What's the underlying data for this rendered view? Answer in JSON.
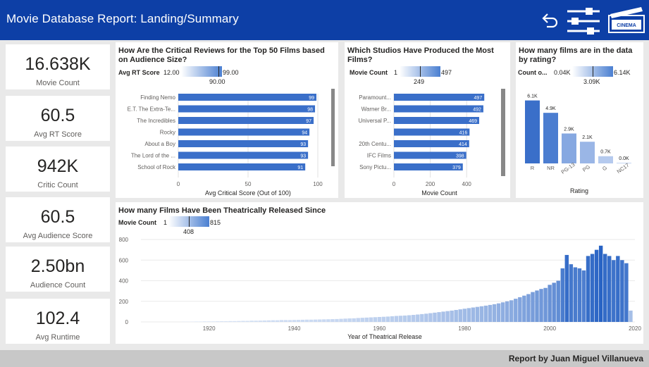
{
  "header": {
    "title": "Movie Database Report: Landing/Summary",
    "logo_text": "CINEMA"
  },
  "kpis": [
    {
      "value": "16.638K",
      "label": "Movie Count"
    },
    {
      "value": "60.5",
      "label": "Avg RT Score"
    },
    {
      "value": "942K",
      "label": "Critic Count"
    },
    {
      "value": "60.5",
      "label": "Avg Audience Score"
    },
    {
      "value": "2.50bn",
      "label": "Audience Count"
    },
    {
      "value": "102.4",
      "label": "Avg Runtime"
    }
  ],
  "reviews": {
    "title": "How Are the Critical Reviews for the Top 50 Films based on Audience Size?",
    "slicer": {
      "label": "Avg RT Score",
      "min": "12.00",
      "max": "99.00",
      "marker": "90.00",
      "marker_frac": 0.91
    }
  },
  "studios": {
    "title": "Which Studios Have Produced the Most Films?",
    "slicer": {
      "label": "Movie Count",
      "min": "1",
      "max": "497",
      "marker": "249",
      "marker_frac": 0.5
    }
  },
  "ratings": {
    "title": "How many films are in the data by rating?",
    "slicer": {
      "label": "Count o...",
      "min": "0.04K",
      "max": "6.14K",
      "marker": "3.09K",
      "marker_frac": 0.5
    }
  },
  "timeline": {
    "title": "How many Films Have Been Theatrically Released Since",
    "slicer": {
      "label": "Movie Count",
      "min": "1",
      "max": "815",
      "marker": "408",
      "marker_frac": 0.5
    }
  },
  "footer": {
    "text": "Report by Juan Miguel Villanueva"
  },
  "colors": {
    "header": "#0d3fa6",
    "bar": "#3a6fc9",
    "bar_light": "#a8c1ea"
  },
  "chart_data": [
    {
      "type": "bar",
      "orientation": "horizontal",
      "categories": [
        "Finding Nemo",
        "E.T. The Extra-Te...",
        "The Incredibles",
        "Rocky",
        "About a Boy",
        "The Lord of the ...",
        "School of Rock"
      ],
      "values": [
        99,
        98,
        97,
        94,
        93,
        93,
        91
      ],
      "xlabel": "Avg Critical Score (Out of 100)",
      "xlim": [
        0,
        100
      ],
      "xticks": [
        "0",
        "50",
        "100"
      ]
    },
    {
      "type": "bar",
      "orientation": "horizontal",
      "categories": [
        "Paramount...",
        "Warner Br...",
        "Universal P...",
        "",
        "20th Centu...",
        "IFC Films",
        "Sony Pictu..."
      ],
      "values": [
        497,
        492,
        469,
        416,
        414,
        398,
        379
      ],
      "xlabel": "Movie Count",
      "xlim": [
        0,
        500
      ],
      "xticks": [
        "0",
        "200",
        "400"
      ]
    },
    {
      "type": "bar",
      "categories": [
        "R",
        "NR",
        "PG-13",
        "PG",
        "G",
        "NC17"
      ],
      "values": [
        6.1,
        4.9,
        2.9,
        2.1,
        0.7,
        0.0
      ],
      "data_labels": [
        "6.1K",
        "4.9K",
        "2.9K",
        "2.1K",
        "0.7K",
        "0.0K"
      ],
      "xlabel": "Rating",
      "ylim": [
        0,
        6.14
      ]
    },
    {
      "type": "bar",
      "x_start": 1914,
      "x": [
        1914,
        1915,
        1916,
        1917,
        1918,
        1919,
        1920,
        1921,
        1922,
        1923,
        1924,
        1925,
        1926,
        1927,
        1928,
        1929,
        1930,
        1931,
        1932,
        1933,
        1934,
        1935,
        1936,
        1937,
        1938,
        1939,
        1940,
        1941,
        1942,
        1943,
        1944,
        1945,
        1946,
        1947,
        1948,
        1949,
        1950,
        1951,
        1952,
        1953,
        1954,
        1955,
        1956,
        1957,
        1958,
        1959,
        1960,
        1961,
        1962,
        1963,
        1964,
        1965,
        1966,
        1967,
        1968,
        1969,
        1970,
        1971,
        1972,
        1973,
        1974,
        1975,
        1976,
        1977,
        1978,
        1979,
        1980,
        1981,
        1982,
        1983,
        1984,
        1985,
        1986,
        1987,
        1988,
        1989,
        1990,
        1991,
        1992,
        1993,
        1994,
        1995,
        1996,
        1997,
        1998,
        1999,
        2000,
        2001,
        2002,
        2003,
        2004,
        2005,
        2006,
        2007,
        2008,
        2009,
        2010,
        2011,
        2012,
        2013,
        2014,
        2015,
        2016,
        2017,
        2018,
        2019
      ],
      "values": [
        2,
        2,
        3,
        4,
        4,
        5,
        5,
        5,
        6,
        7,
        7,
        8,
        8,
        9,
        10,
        10,
        12,
        12,
        13,
        14,
        15,
        16,
        16,
        18,
        18,
        18,
        19,
        20,
        21,
        22,
        22,
        23,
        24,
        25,
        26,
        27,
        28,
        30,
        32,
        34,
        35,
        38,
        40,
        42,
        44,
        46,
        48,
        50,
        52,
        55,
        58,
        60,
        62,
        65,
        68,
        72,
        76,
        80,
        85,
        90,
        95,
        100,
        105,
        110,
        116,
        122,
        128,
        134,
        140,
        146,
        152,
        158,
        165,
        172,
        180,
        190,
        200,
        210,
        225,
        240,
        255,
        270,
        290,
        305,
        320,
        330,
        360,
        380,
        400,
        520,
        650,
        560,
        530,
        520,
        500,
        640,
        660,
        700,
        740,
        660,
        640,
        600,
        640,
        600,
        570,
        110
      ],
      "xlabel": "Year of Theatrical Release",
      "ylim": [
        0,
        800
      ],
      "yticks": [
        "0",
        "200",
        "400",
        "600",
        "800"
      ],
      "xticks": [
        "1920",
        "1940",
        "1960",
        "1980",
        "2000",
        "2020"
      ]
    }
  ]
}
